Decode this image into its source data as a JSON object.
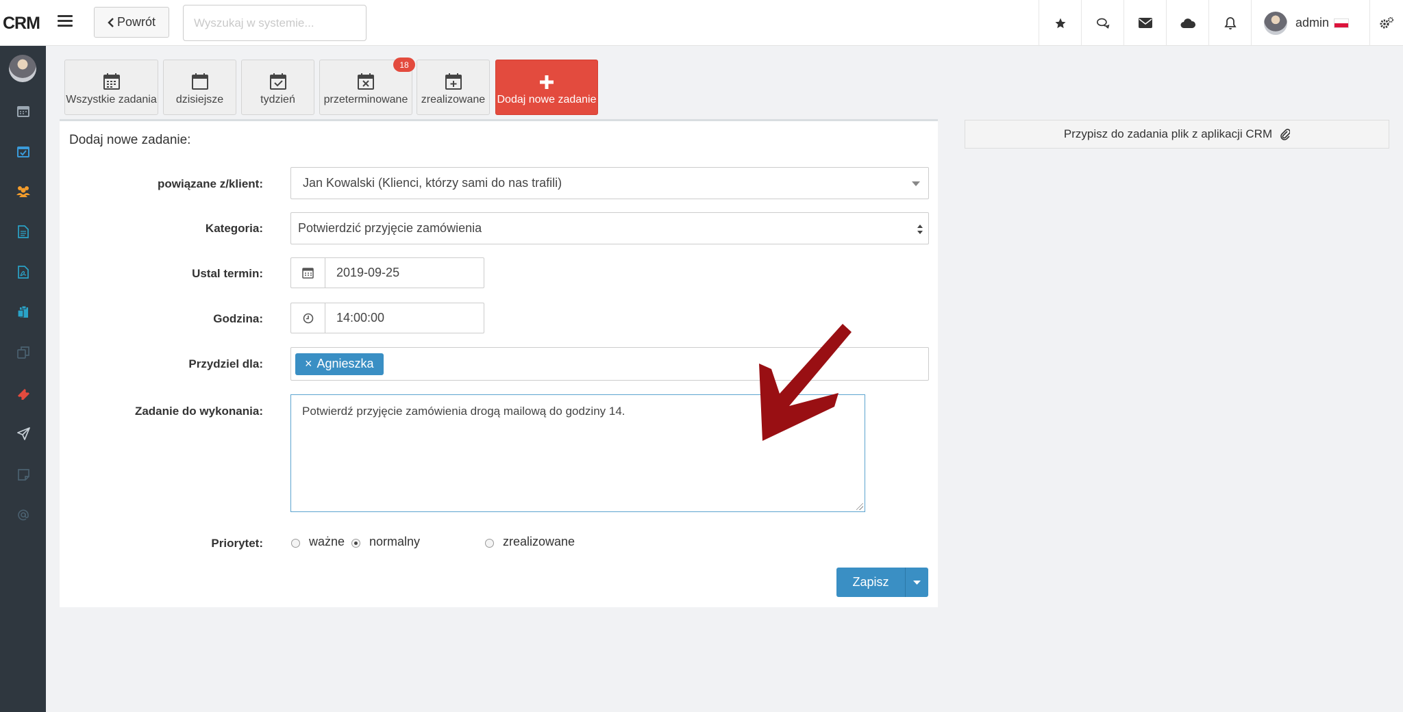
{
  "topbar": {
    "logo": "CRM",
    "back_label": "Powrót",
    "search_placeholder": "Wyszukaj w systemie...",
    "user_name": "admin"
  },
  "toolbar": {
    "all_tasks": "Wszystkie zadania",
    "today": "dzisiejsze",
    "week": "tydzień",
    "overdue": "przeterminowane",
    "overdue_count": "18",
    "done": "zrealizowane",
    "add_new": "Dodaj nowe zadanie"
  },
  "form": {
    "title": "Dodaj nowe zadanie:",
    "client_label": "powiązane z/klient:",
    "client_value": "Jan Kowalski (Klienci, którzy sami do nas trafili)",
    "category_label": "Kategoria:",
    "category_value": "Potwierdzić przyjęcie zamówienia",
    "date_label": "Ustal termin:",
    "date_value": "2019-09-25",
    "time_label": "Godzina:",
    "time_value": "14:00:00",
    "assign_label": "Przydziel dla:",
    "assign_tag": "Agnieszka",
    "tag_remove": "×",
    "task_label": "Zadanie do wykonania:",
    "task_value": "Potwierdź przyjęcie zamówienia drogą mailową do godziny 14.",
    "priority_label": "Priorytet:",
    "priority_options": [
      "ważne",
      "normalny",
      "zrealizowane"
    ],
    "priority_selected": "normalny",
    "save_label": "Zapisz"
  },
  "attach": {
    "label": "Przypisz do zadania plik z aplikacji CRM"
  },
  "colors": {
    "accent": "#3a8fc4",
    "danger": "#e34b3e",
    "sidebar": "#2f373f",
    "arrow": "#990f13"
  },
  "icons": {
    "topbar": [
      "star-icon",
      "chat-icon",
      "envelope-icon",
      "cloud-icon",
      "bell-icon",
      "gears-icon"
    ],
    "sidebar": [
      "calendar-icon",
      "calendar-check-icon",
      "users-icon",
      "document-icon",
      "pdf-icon",
      "clipboard-icon",
      "copy-icon",
      "ticket-icon",
      "send-icon",
      "note-icon",
      "at-icon"
    ]
  }
}
